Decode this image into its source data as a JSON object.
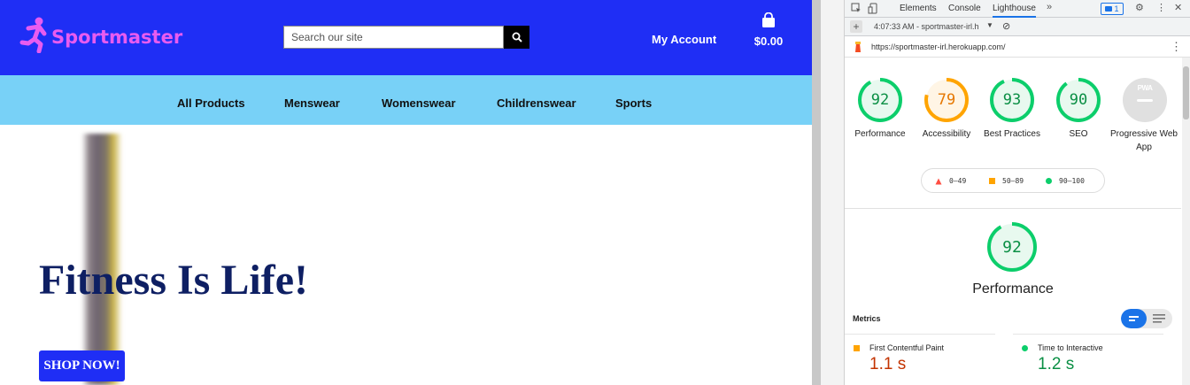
{
  "site": {
    "brand": "Sportmaster",
    "search_placeholder": "Search our site",
    "account_label": "My Account",
    "cart_total": "$0.00",
    "nav": [
      "All Products",
      "Menswear",
      "Womenswear",
      "Childrenswear",
      "Sports"
    ],
    "hero_title": "Fitness Is Life!",
    "hero_button": "SHOP NOW!",
    "colors": {
      "topbar": "#1f2ef5",
      "navbar": "#78d1f7",
      "brand": "#e85cf0",
      "hero_title": "#0e1f63"
    }
  },
  "devtools": {
    "tabs": [
      "Elements",
      "Console",
      "Lighthouse"
    ],
    "active_tab": "Lighthouse",
    "issues_count": "1",
    "report_select": "4:07:33 AM - sportmaster-irl.h",
    "url": "https://sportmaster-irl.herokuapp.com/",
    "scores": [
      {
        "label": "Performance",
        "value": "92",
        "color": "#0cce6b"
      },
      {
        "label": "Accessibility",
        "value": "79",
        "color": "#ffa400"
      },
      {
        "label": "Best Practices",
        "value": "93",
        "color": "#0cce6b"
      },
      {
        "label": "SEO",
        "value": "90",
        "color": "#0cce6b"
      },
      {
        "label": "Progressive Web App",
        "value": "PWA",
        "color": "#9e9e9e"
      }
    ],
    "legend": [
      {
        "range": "0–49",
        "color": "#ff4e42"
      },
      {
        "range": "50–89",
        "color": "#ffa400"
      },
      {
        "range": "90–100",
        "color": "#0cce6b"
      }
    ],
    "performance_title": "Performance",
    "performance_score": "92",
    "metrics_label": "Metrics",
    "metrics": [
      {
        "name": "First Contentful Paint",
        "value": "1.1 s",
        "color": "#c33300",
        "dot": "#ffa400"
      },
      {
        "name": "Time to Interactive",
        "value": "1.2 s",
        "color": "#0a8f44",
        "dot": "#0cce6b"
      }
    ]
  }
}
